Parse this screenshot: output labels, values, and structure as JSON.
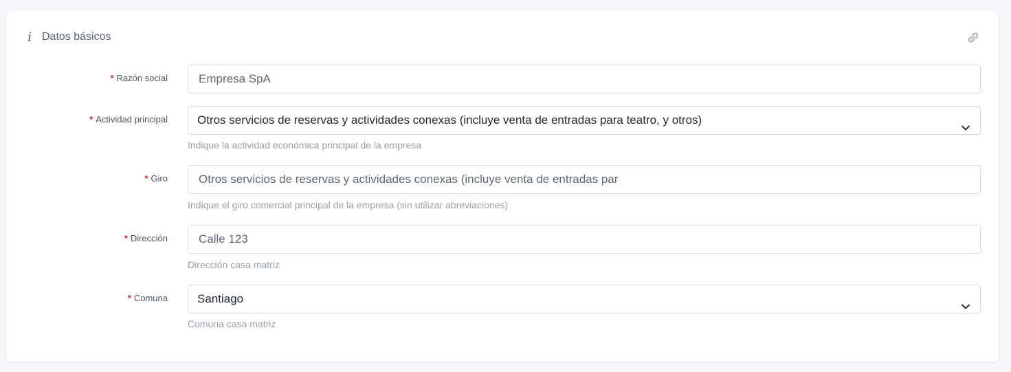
{
  "card": {
    "title": "Datos básicos",
    "info_icon": "info-icon",
    "link_icon": "link-icon"
  },
  "form": {
    "required_marker": "*",
    "fields": [
      {
        "label": "Razón social",
        "type": "input",
        "value": "Empresa SpA",
        "help": ""
      },
      {
        "label": "Actividad principal",
        "type": "select",
        "value": "Otros servicios de reservas y actividades conexas (incluye venta de entradas para teatro, y otros)",
        "help": "Indique la actividad económica principal de la empresa"
      },
      {
        "label": "Giro",
        "type": "input",
        "value": "Otros servicios de reservas y actividades conexas (incluye venta de entradas par",
        "help": "Indique el giro comercial principal de la empresa (sin utilizar abreviaciones)"
      },
      {
        "label": "Dirección",
        "type": "input",
        "value": "Calle 123",
        "help": "Dirección casa matriz"
      },
      {
        "label": "Comuna",
        "type": "select",
        "value": "Santiago",
        "help": "Comuna casa matriz"
      }
    ]
  },
  "colors": {
    "required": "#e0262e",
    "border": "#d8dce3",
    "help_text": "#9aa0ab",
    "page_bg": "#f5f6f9"
  }
}
